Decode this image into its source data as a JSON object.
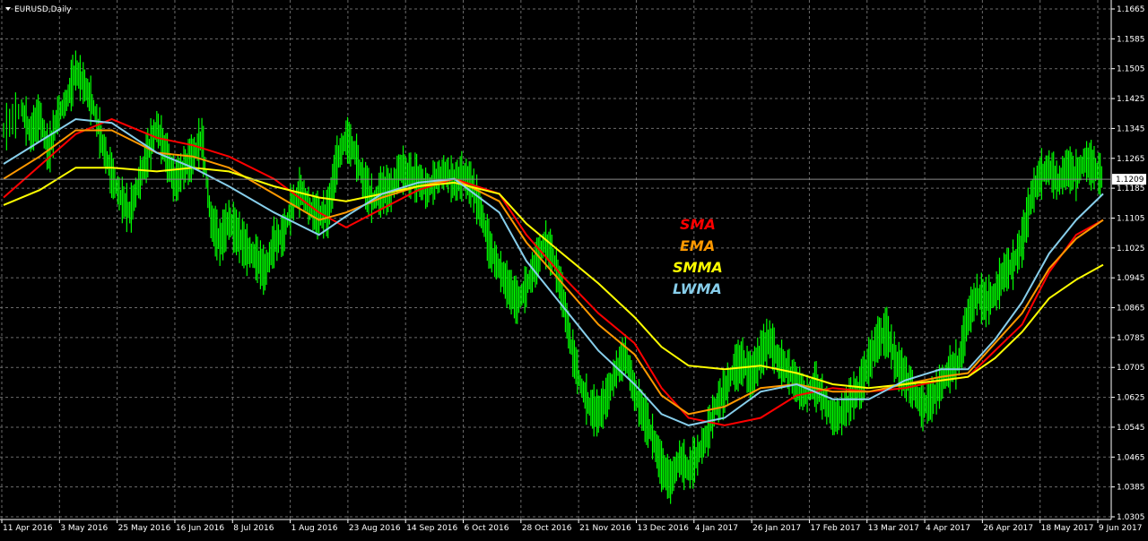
{
  "chart_data": {
    "type": "candlestick-line",
    "title": "EURUSD,Daily",
    "current_price": "1.1209",
    "grid": true,
    "background": "#000000",
    "grid_color": "#6b6b6b",
    "price_bar_color": "#00ff00",
    "ylim": [
      1.03,
      1.167
    ],
    "y_ticks": [
      "1.1665",
      "1.1585",
      "1.1505",
      "1.1425",
      "1.1345",
      "1.1265",
      "1.1185",
      "1.1105",
      "1.1025",
      "1.0945",
      "1.0865",
      "1.0785",
      "1.0705",
      "1.0625",
      "1.0545",
      "1.0465",
      "1.0385",
      "1.0305"
    ],
    "x_ticks": [
      "11 Apr 2016",
      "3 May 2016",
      "25 May 2016",
      "16 Jun 2016",
      "8 Jul 2016",
      "1 Aug 2016",
      "23 Aug 2016",
      "14 Sep 2016",
      "6 Oct 2016",
      "28 Oct 2016",
      "21 Nov 2016",
      "13 Dec 2016",
      "4 Jan 2017",
      "26 Jan 2017",
      "17 Feb 2017",
      "13 Mar 2017",
      "4 Apr 2017",
      "26 Apr 2017",
      "18 May 2017",
      "9 Jun 2017"
    ],
    "legend": [
      {
        "name": "SMA",
        "color": "#ff0000"
      },
      {
        "name": "EMA",
        "color": "#ff9900"
      },
      {
        "name": "SMMA",
        "color": "#ffff00"
      },
      {
        "name": "LWMA",
        "color": "#87ceeb"
      }
    ],
    "price_close": [
      [
        0,
        1.134
      ],
      [
        2,
        1.14
      ],
      [
        3,
        1.133
      ],
      [
        4,
        1.138
      ],
      [
        5,
        1.128
      ],
      [
        6,
        1.138
      ],
      [
        7,
        1.142
      ],
      [
        8,
        1.15
      ],
      [
        9,
        1.146
      ],
      [
        10,
        1.14
      ],
      [
        11,
        1.13
      ],
      [
        12,
        1.122
      ],
      [
        13,
        1.116
      ],
      [
        14,
        1.112
      ],
      [
        15,
        1.12
      ],
      [
        16,
        1.128
      ],
      [
        17,
        1.135
      ],
      [
        18,
        1.128
      ],
      [
        19,
        1.12
      ],
      [
        20,
        1.124
      ],
      [
        21,
        1.127
      ],
      [
        22,
        1.132
      ],
      [
        23,
        1.11
      ],
      [
        24,
        1.104
      ],
      [
        25,
        1.11
      ],
      [
        26,
        1.106
      ],
      [
        27,
        1.102
      ],
      [
        28,
        1.1
      ],
      [
        29,
        1.096
      ],
      [
        30,
        1.104
      ],
      [
        31,
        1.106
      ],
      [
        32,
        1.114
      ],
      [
        33,
        1.118
      ],
      [
        34,
        1.113
      ],
      [
        35,
        1.111
      ],
      [
        36,
        1.112
      ],
      [
        37,
        1.126
      ],
      [
        38,
        1.132
      ],
      [
        39,
        1.128
      ],
      [
        40,
        1.12
      ],
      [
        41,
        1.115
      ],
      [
        42,
        1.118
      ],
      [
        43,
        1.118
      ],
      [
        44,
        1.124
      ],
      [
        45,
        1.122
      ],
      [
        46,
        1.121
      ],
      [
        47,
        1.118
      ],
      [
        48,
        1.121
      ],
      [
        49,
        1.123
      ],
      [
        50,
        1.12
      ],
      [
        51,
        1.122
      ],
      [
        52,
        1.119
      ],
      [
        53,
        1.112
      ],
      [
        54,
        1.102
      ],
      [
        55,
        1.097
      ],
      [
        56,
        1.092
      ],
      [
        57,
        1.088
      ],
      [
        58,
        1.092
      ],
      [
        59,
        1.098
      ],
      [
        60,
        1.104
      ],
      [
        61,
        1.1
      ],
      [
        62,
        1.09
      ],
      [
        63,
        1.076
      ],
      [
        64,
        1.066
      ],
      [
        65,
        1.06
      ],
      [
        66,
        1.058
      ],
      [
        67,
        1.063
      ],
      [
        68,
        1.07
      ],
      [
        69,
        1.074
      ],
      [
        70,
        1.064
      ],
      [
        71,
        1.058
      ],
      [
        72,
        1.052
      ],
      [
        73,
        1.044
      ],
      [
        74,
        1.04
      ],
      [
        75,
        1.046
      ],
      [
        76,
        1.043
      ],
      [
        77,
        1.047
      ],
      [
        78,
        1.052
      ],
      [
        79,
        1.06
      ],
      [
        80,
        1.064
      ],
      [
        81,
        1.07
      ],
      [
        82,
        1.072
      ],
      [
        83,
        1.068
      ],
      [
        84,
        1.074
      ],
      [
        85,
        1.078
      ],
      [
        86,
        1.072
      ],
      [
        87,
        1.07
      ],
      [
        88,
        1.066
      ],
      [
        89,
        1.063
      ],
      [
        90,
        1.066
      ],
      [
        91,
        1.062
      ],
      [
        92,
        1.057
      ],
      [
        93,
        1.058
      ],
      [
        94,
        1.062
      ],
      [
        95,
        1.065
      ],
      [
        96,
        1.072
      ],
      [
        97,
        1.078
      ],
      [
        98,
        1.08
      ],
      [
        99,
        1.072
      ],
      [
        100,
        1.068
      ],
      [
        101,
        1.064
      ],
      [
        102,
        1.06
      ],
      [
        103,
        1.062
      ],
      [
        104,
        1.066
      ],
      [
        105,
        1.07
      ],
      [
        106,
        1.072
      ],
      [
        107,
        1.084
      ],
      [
        108,
        1.09
      ],
      [
        109,
        1.088
      ],
      [
        110,
        1.09
      ],
      [
        111,
        1.096
      ],
      [
        112,
        1.098
      ],
      [
        113,
        1.104
      ],
      [
        114,
        1.116
      ],
      [
        115,
        1.122
      ],
      [
        116,
        1.124
      ],
      [
        117,
        1.12
      ],
      [
        118,
        1.124
      ],
      [
        119,
        1.122
      ],
      [
        120,
        1.126
      ],
      [
        121,
        1.124
      ],
      [
        122,
        1.121
      ]
    ],
    "series": [
      {
        "name": "SMA",
        "color": "#ff0000",
        "values": [
          [
            0,
            1.116
          ],
          [
            8,
            1.133
          ],
          [
            12,
            1.137
          ],
          [
            17,
            1.132
          ],
          [
            21,
            1.13
          ],
          [
            25,
            1.127
          ],
          [
            30,
            1.121
          ],
          [
            35,
            1.112
          ],
          [
            38,
            1.108
          ],
          [
            42,
            1.113
          ],
          [
            46,
            1.118
          ],
          [
            50,
            1.121
          ],
          [
            55,
            1.117
          ],
          [
            58,
            1.106
          ],
          [
            62,
            1.095
          ],
          [
            66,
            1.085
          ],
          [
            70,
            1.077
          ],
          [
            73,
            1.065
          ],
          [
            76,
            1.057
          ],
          [
            80,
            1.055
          ],
          [
            84,
            1.057
          ],
          [
            88,
            1.063
          ],
          [
            92,
            1.065
          ],
          [
            96,
            1.064
          ],
          [
            100,
            1.065
          ],
          [
            104,
            1.067
          ],
          [
            107,
            1.068
          ],
          [
            110,
            1.075
          ],
          [
            113,
            1.082
          ],
          [
            116,
            1.096
          ],
          [
            119,
            1.106
          ],
          [
            122,
            1.11
          ]
        ]
      },
      {
        "name": "EMA",
        "color": "#ff9900",
        "values": [
          [
            0,
            1.121
          ],
          [
            4,
            1.127
          ],
          [
            8,
            1.134
          ],
          [
            12,
            1.134
          ],
          [
            17,
            1.128
          ],
          [
            21,
            1.127
          ],
          [
            25,
            1.124
          ],
          [
            30,
            1.117
          ],
          [
            35,
            1.11
          ],
          [
            38,
            1.112
          ],
          [
            42,
            1.116
          ],
          [
            46,
            1.119
          ],
          [
            50,
            1.121
          ],
          [
            55,
            1.115
          ],
          [
            58,
            1.104
          ],
          [
            62,
            1.093
          ],
          [
            66,
            1.082
          ],
          [
            70,
            1.074
          ],
          [
            73,
            1.063
          ],
          [
            76,
            1.058
          ],
          [
            80,
            1.06
          ],
          [
            84,
            1.065
          ],
          [
            88,
            1.066
          ],
          [
            92,
            1.064
          ],
          [
            96,
            1.064
          ],
          [
            100,
            1.066
          ],
          [
            104,
            1.068
          ],
          [
            107,
            1.069
          ],
          [
            110,
            1.077
          ],
          [
            113,
            1.085
          ],
          [
            116,
            1.097
          ],
          [
            119,
            1.105
          ],
          [
            122,
            1.11
          ]
        ]
      },
      {
        "name": "SMMA",
        "color": "#ffff00",
        "values": [
          [
            0,
            1.114
          ],
          [
            4,
            1.118
          ],
          [
            8,
            1.124
          ],
          [
            12,
            1.124
          ],
          [
            17,
            1.123
          ],
          [
            21,
            1.124
          ],
          [
            25,
            1.123
          ],
          [
            30,
            1.119
          ],
          [
            35,
            1.116
          ],
          [
            38,
            1.115
          ],
          [
            42,
            1.117
          ],
          [
            46,
            1.119
          ],
          [
            50,
            1.12
          ],
          [
            55,
            1.117
          ],
          [
            58,
            1.109
          ],
          [
            62,
            1.101
          ],
          [
            66,
            1.093
          ],
          [
            70,
            1.084
          ],
          [
            73,
            1.076
          ],
          [
            76,
            1.071
          ],
          [
            80,
            1.07
          ],
          [
            84,
            1.071
          ],
          [
            88,
            1.069
          ],
          [
            92,
            1.066
          ],
          [
            96,
            1.065
          ],
          [
            100,
            1.066
          ],
          [
            104,
            1.067
          ],
          [
            107,
            1.068
          ],
          [
            110,
            1.073
          ],
          [
            113,
            1.08
          ],
          [
            116,
            1.089
          ],
          [
            119,
            1.094
          ],
          [
            122,
            1.098
          ]
        ]
      },
      {
        "name": "LWMA",
        "color": "#87ceeb",
        "values": [
          [
            0,
            1.125
          ],
          [
            4,
            1.131
          ],
          [
            8,
            1.137
          ],
          [
            12,
            1.136
          ],
          [
            17,
            1.128
          ],
          [
            21,
            1.124
          ],
          [
            25,
            1.119
          ],
          [
            30,
            1.112
          ],
          [
            35,
            1.106
          ],
          [
            38,
            1.111
          ],
          [
            42,
            1.117
          ],
          [
            46,
            1.12
          ],
          [
            50,
            1.121
          ],
          [
            55,
            1.112
          ],
          [
            58,
            1.099
          ],
          [
            62,
            1.087
          ],
          [
            66,
            1.075
          ],
          [
            70,
            1.066
          ],
          [
            73,
            1.058
          ],
          [
            76,
            1.055
          ],
          [
            80,
            1.057
          ],
          [
            84,
            1.064
          ],
          [
            88,
            1.066
          ],
          [
            92,
            1.062
          ],
          [
            96,
            1.062
          ],
          [
            100,
            1.067
          ],
          [
            104,
            1.07
          ],
          [
            107,
            1.07
          ],
          [
            110,
            1.078
          ],
          [
            113,
            1.088
          ],
          [
            116,
            1.101
          ],
          [
            119,
            1.11
          ],
          [
            122,
            1.117
          ]
        ]
      }
    ]
  }
}
